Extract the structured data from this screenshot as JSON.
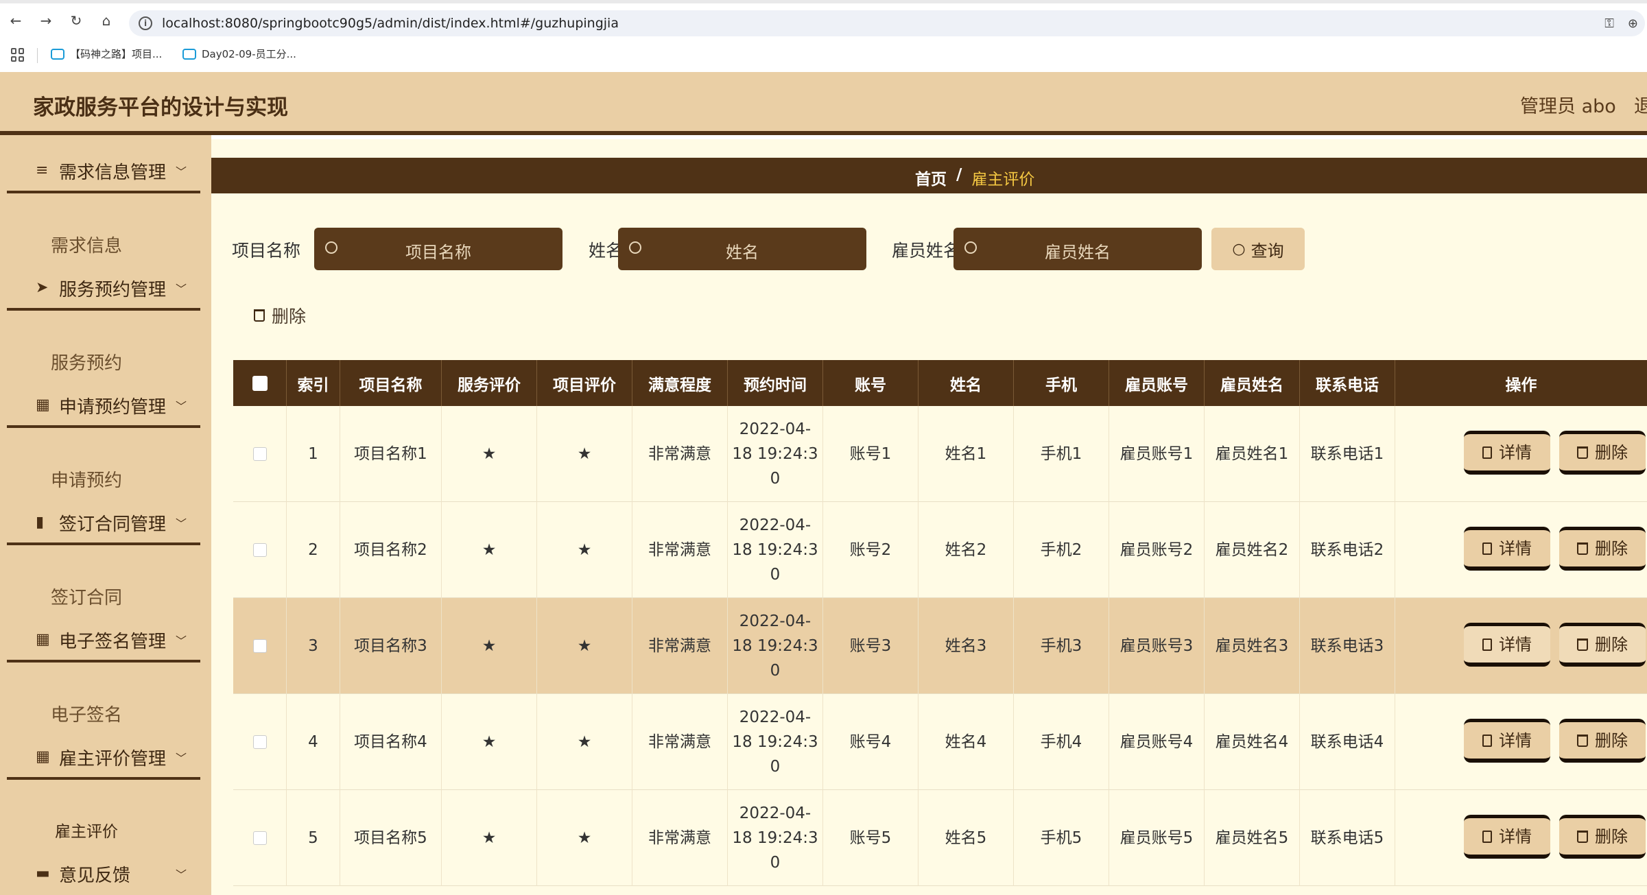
{
  "browser": {
    "url": "localhost:8080/springbootc90g5/admin/dist/index.html#/guzhupingjia",
    "bookmarks": [
      "【码神之路】项目...",
      "Day02-09-员工分..."
    ]
  },
  "header": {
    "title": "家政服务平台的设计与实现",
    "user": "管理员 abo",
    "logout": "退"
  },
  "sidebar": {
    "groups": [
      {
        "label": "需求信息管理",
        "sub": "需求信息",
        "icon": "list-icon"
      },
      {
        "label": "服务预约管理",
        "sub": "服务预约",
        "icon": "send-icon"
      },
      {
        "label": "申请预约管理",
        "sub": "申请预约",
        "icon": "grid-icon"
      },
      {
        "label": "签订合同管理",
        "sub": "签订合同",
        "icon": "chart-icon"
      },
      {
        "label": "电子签名管理",
        "sub": "电子签名",
        "icon": "grid-icon"
      },
      {
        "label": "雇主评价管理",
        "sub": "雇主评价",
        "icon": "grid-icon"
      },
      {
        "label": "意见反馈",
        "sub": "",
        "icon": "monitor-icon"
      }
    ]
  },
  "breadcrumb": {
    "home": "首页",
    "sep": "/",
    "current": "雇主评价"
  },
  "search": {
    "label1": "项目名称",
    "placeholder1": "项目名称",
    "label2": "姓名",
    "placeholder2": "姓名",
    "label3": "雇员姓名",
    "placeholder3": "雇员姓名",
    "query": "查询"
  },
  "actions": {
    "delete_batch": "删除"
  },
  "table": {
    "headers": [
      "索引",
      "项目名称",
      "服务评价",
      "项目评价",
      "满意程度",
      "预约时间",
      "账号",
      "姓名",
      "手机",
      "雇员账号",
      "雇员姓名",
      "联系电话",
      "操作"
    ],
    "detail_label": "详情",
    "delete_label": "删除",
    "rows": [
      {
        "idx": "1",
        "name": "项目名称1",
        "service": "★",
        "project": "★",
        "satisfaction": "非常满意",
        "time1": "2022-04-",
        "time2": "18 19:24:3",
        "time3": "0",
        "account": "账号1",
        "username": "姓名1",
        "phone": "手机1",
        "emp_account": "雇员账号1",
        "emp_name": "雇员姓名1",
        "contact": "联系电话1"
      },
      {
        "idx": "2",
        "name": "项目名称2",
        "service": "★",
        "project": "★",
        "satisfaction": "非常满意",
        "time1": "2022-04-",
        "time2": "18 19:24:3",
        "time3": "0",
        "account": "账号2",
        "username": "姓名2",
        "phone": "手机2",
        "emp_account": "雇员账号2",
        "emp_name": "雇员姓名2",
        "contact": "联系电话2"
      },
      {
        "idx": "3",
        "name": "项目名称3",
        "service": "★",
        "project": "★",
        "satisfaction": "非常满意",
        "time1": "2022-04-",
        "time2": "18 19:24:3",
        "time3": "0",
        "account": "账号3",
        "username": "姓名3",
        "phone": "手机3",
        "emp_account": "雇员账号3",
        "emp_name": "雇员姓名3",
        "contact": "联系电话3"
      },
      {
        "idx": "4",
        "name": "项目名称4",
        "service": "★",
        "project": "★",
        "satisfaction": "非常满意",
        "time1": "2022-04-",
        "time2": "18 19:24:3",
        "time3": "0",
        "account": "账号4",
        "username": "姓名4",
        "phone": "手机4",
        "emp_account": "雇员账号4",
        "emp_name": "雇员姓名4",
        "contact": "联系电话4"
      },
      {
        "idx": "5",
        "name": "项目名称5",
        "service": "★",
        "project": "★",
        "satisfaction": "非常满意",
        "time1": "2022-04-",
        "time2": "18 19:24:3",
        "time3": "0",
        "account": "账号5",
        "username": "姓名5",
        "phone": "手机5",
        "emp_account": "雇员账号5",
        "emp_name": "雇员姓名5",
        "contact": "联系电话5"
      }
    ]
  },
  "colors": {
    "brand_dark": "#4f3216",
    "brand_light": "#eacfa5",
    "main_bg": "#fffbe5",
    "accent": "#f5c842"
  }
}
